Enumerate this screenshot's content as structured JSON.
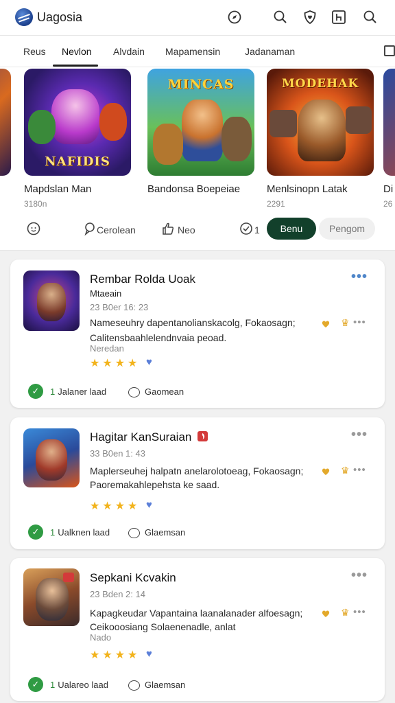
{
  "app": {
    "title": "Uagosia"
  },
  "header_icons": [
    "compass-icon",
    "search-icon",
    "heart-shield-icon",
    "h-box-icon",
    "search-icon"
  ],
  "tabs": [
    {
      "label": "Reus"
    },
    {
      "label": "Nevlon"
    },
    {
      "label": "Alvdain"
    },
    {
      "label": "Mapamensin"
    },
    {
      "label": "Jadanaman"
    }
  ],
  "carousel": {
    "games": [
      {
        "name": "Mapdslan Man",
        "meta": "3180n",
        "banner": "NAFIDIS"
      },
      {
        "name": "Bandonsa Boepeiae",
        "meta": "",
        "banner": "MINCAS"
      },
      {
        "name": "Menlsinopn Latak",
        "meta": "2291",
        "banner": "MODEHAK"
      },
      {
        "name": "Di",
        "meta": "26"
      }
    ],
    "actions": {
      "react_count": "",
      "comment_label": "Cerolean",
      "like_label": "Neo",
      "count_label": "1",
      "primary_button": "Benu",
      "secondary_button": "Pengom"
    }
  },
  "posts": [
    {
      "title": "Rembar Rolda Uoak",
      "subtitle": "Mtaeain",
      "time": "23 B0er 16: 23",
      "body1": "Nameseuhry dapentanolianskacolg, Fokaosagn;",
      "body2": "Calitensbaahlelendnvaia peoad.",
      "tag": "Neredan",
      "stars": "★★★★",
      "footer_count": "1",
      "footer_label": "Jalaner laad",
      "comment_label": "Gaomean"
    },
    {
      "title": "Hagitar KanSuraian",
      "subtitle": "",
      "time": "33 B0en 1: 43",
      "body1": "Maplerseuhej halpatn anelarolotoeag, Fokaosagn;",
      "body2": "Paoremakahlepehsta ke saad.",
      "tag": "",
      "stars": "★★★★",
      "footer_count": "1",
      "footer_label": "Ualknen laad",
      "comment_label": "Glaemsan"
    },
    {
      "title": "Sepkani Kcvakin",
      "subtitle": "",
      "time": "23 Bden 2: 14",
      "body1": "Kapagkeudar Vapantaina laanalanader alfoesagn;",
      "body2": "Ceikooosiang Solaenenadle, anlat",
      "tag": "Nado",
      "stars": "★★★★",
      "footer_count": "1",
      "footer_label": "Ualareo laad",
      "comment_label": "Glaemsan"
    }
  ],
  "colors": {
    "primary_button": "#12402b",
    "verified": "#2f9b43",
    "star": "#f2b31c",
    "link_blue": "#4f86c9"
  }
}
